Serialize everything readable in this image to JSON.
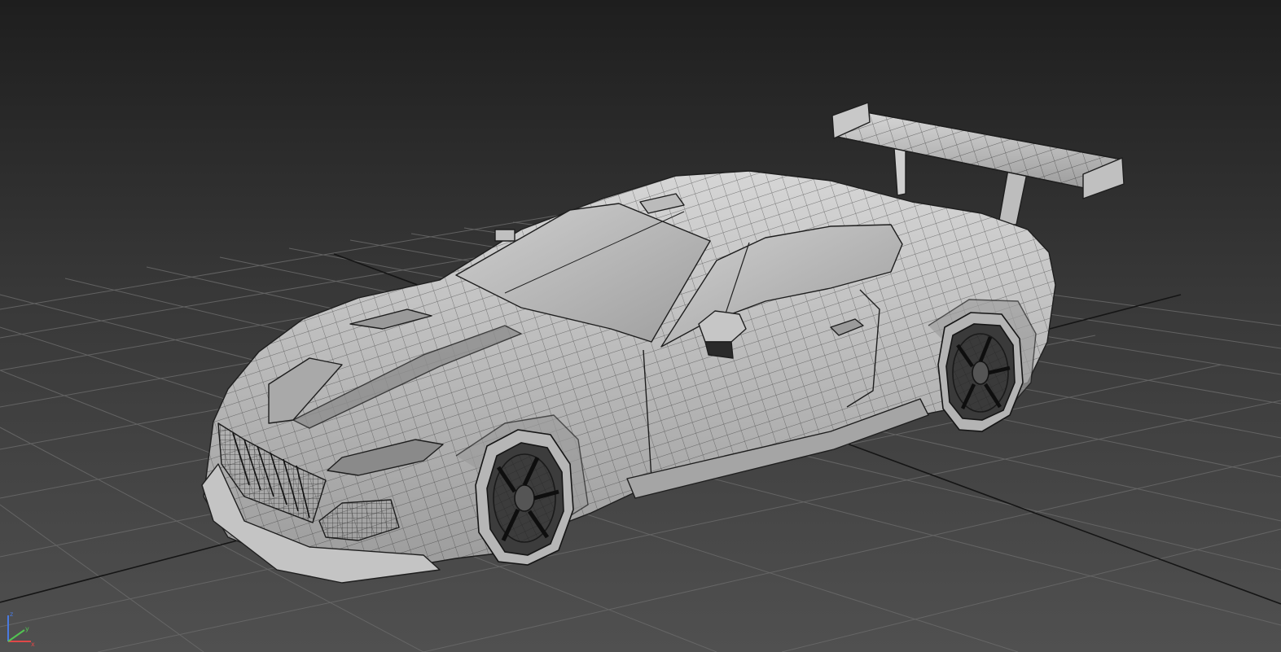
{
  "viewport": {
    "view": "perspective",
    "shading": "shaded-with-wireframe",
    "background_top": "#1f1f1f",
    "background_bottom": "#4e4e4e",
    "grid_color": "#6a6a6a",
    "grid_major_color": "#1a1a1a",
    "model": {
      "subject": "race-car",
      "body_color": "#bdbdbd",
      "wire_color": "#222222"
    },
    "gizmo": {
      "x_color": "#e04848",
      "y_color": "#52c452",
      "z_color": "#4a7ae0"
    }
  }
}
